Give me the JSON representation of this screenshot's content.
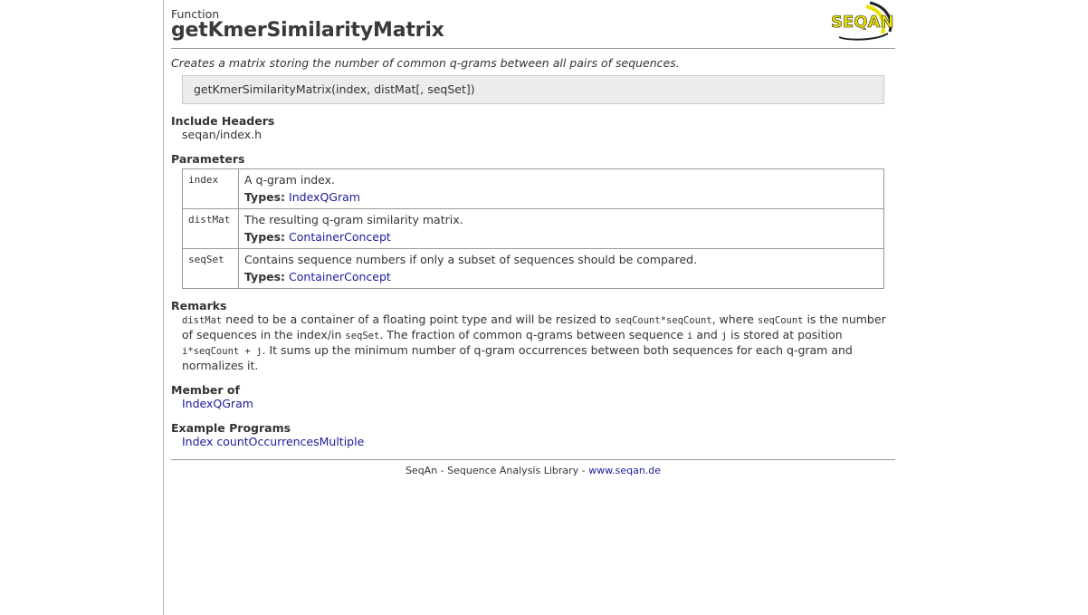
{
  "header": {
    "kind": "Function",
    "title": "getKmerSimilarityMatrix",
    "logo_text": "SEQAN"
  },
  "summary": "Creates a matrix storing the number of common q-grams between all pairs of sequences.",
  "signature": "getKmerSimilarityMatrix(index, distMat[, seqSet])",
  "include": {
    "title": "Include Headers",
    "value": "seqan/index.h"
  },
  "parameters": {
    "title": "Parameters",
    "types_label": "Types:",
    "rows": [
      {
        "name": "index",
        "desc": "A q-gram index.",
        "type": "IndexQGram"
      },
      {
        "name": "distMat",
        "desc": "The resulting q-gram similarity matrix.",
        "type": "ContainerConcept"
      },
      {
        "name": "seqSet",
        "desc": "Contains sequence numbers if only a subset of sequences should be compared.",
        "type": "ContainerConcept"
      }
    ]
  },
  "remarks": {
    "title": "Remarks",
    "parts": [
      {
        "kind": "code",
        "text": "distMat"
      },
      {
        "kind": "text",
        "text": " need to be a container of a floating point type and will be resized to "
      },
      {
        "kind": "code",
        "text": "seqCount*seqCount"
      },
      {
        "kind": "text",
        "text": ", where "
      },
      {
        "kind": "code",
        "text": "seqCount"
      },
      {
        "kind": "text",
        "text": " is the number of sequences in the index/in "
      },
      {
        "kind": "code",
        "text": "seqSet"
      },
      {
        "kind": "text",
        "text": ". The fraction of common q-grams between sequence "
      },
      {
        "kind": "code",
        "text": "i"
      },
      {
        "kind": "text",
        "text": " and "
      },
      {
        "kind": "code",
        "text": "j"
      },
      {
        "kind": "text",
        "text": " is stored at position "
      },
      {
        "kind": "code",
        "text": "i*seqCount + j"
      },
      {
        "kind": "text",
        "text": ". It sums up the minimum number of q-gram occurrences between both sequences for each q-gram and normalizes it."
      }
    ]
  },
  "member_of": {
    "title": "Member of",
    "link": "IndexQGram"
  },
  "examples": {
    "title": "Example Programs",
    "link": "Index countOccurrencesMultiple"
  },
  "footer": {
    "text": "SeqAn - Sequence Analysis Library - ",
    "link": "www.seqan.de"
  },
  "colors": {
    "link": "#1b1b9a",
    "logo_yellow": "#e8e000",
    "signature_bg": "#ececec"
  }
}
